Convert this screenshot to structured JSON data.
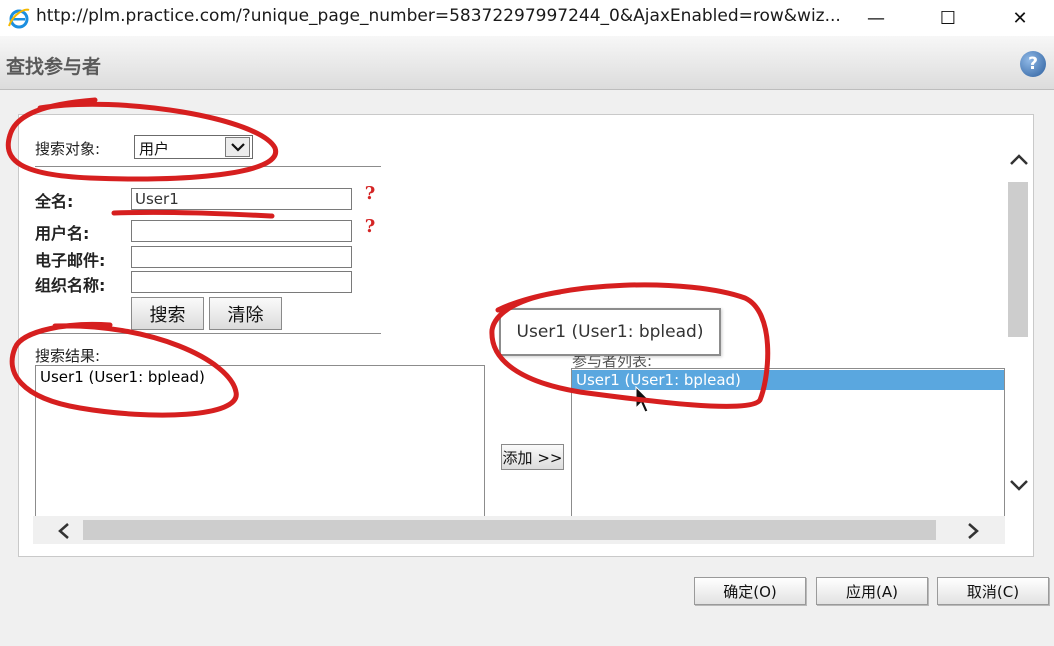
{
  "window": {
    "url": "http://plm.practice.com/?unique_page_number=58372297997244_0&AjaxEnabled=row&wiz...",
    "minimize": "—",
    "maximize": "☐",
    "close": "✕"
  },
  "dialog": {
    "title": "查找参与者",
    "help": "?"
  },
  "search": {
    "object_label": "搜索对象:",
    "object_value": "用户",
    "fullname_label": "全名:",
    "fullname_value": "User1",
    "username_label": "用户名:",
    "username_value": "",
    "email_label": "电子邮件:",
    "email_value": "",
    "org_label": "组织名称:",
    "org_value": "",
    "search_button": "搜索",
    "clear_button": "清除"
  },
  "results": {
    "label": "搜索结果:",
    "items": [
      "User1 (User1: bplead)"
    ]
  },
  "add_button": "添加 >>",
  "participants": {
    "label": "参与者列表:",
    "items": [
      "User1 (User1: bplead)"
    ],
    "tooltip": "User1 (User1: bplead)"
  },
  "footer": {
    "ok": "确定(O)",
    "apply": "应用(A)",
    "cancel": "取消(C)"
  },
  "colors": {
    "annotation": "#d61f1f",
    "selection": "#5aa7df"
  }
}
